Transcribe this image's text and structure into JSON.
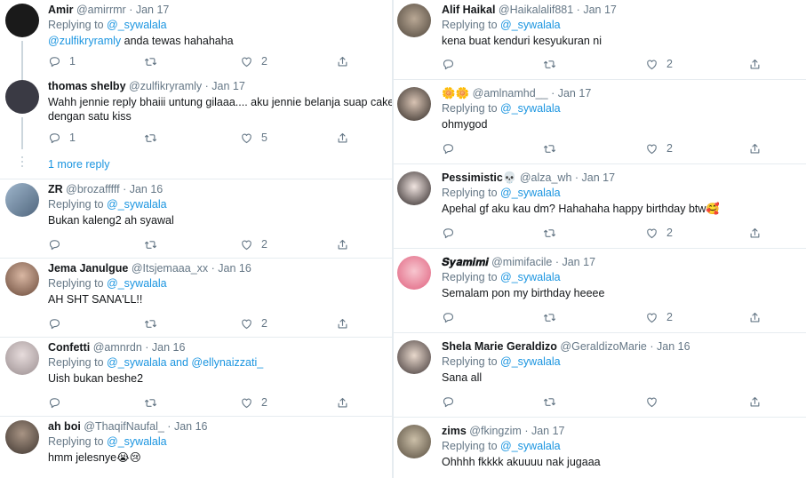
{
  "left": [
    {
      "name": "Amir",
      "handle": "@amirrmr",
      "date": "Jan 17",
      "reply_prefix": "Replying to",
      "reply_to": "@_sywalala",
      "reply_to2": "",
      "text_mention": "@zulfikryramly",
      "text": " anda tewas hahahaha",
      "text2": "",
      "replies": "1",
      "retweets": "",
      "likes": "2",
      "avatar": "#1a1a1a"
    },
    {
      "name": "thomas shelby",
      "handle": "@zulfikryramly",
      "date": "Jan 17",
      "reply_prefix": "",
      "reply_to": "",
      "reply_to2": "",
      "text_mention": "",
      "text": "Wahh jennie reply bhaiii untung gilaaa.... aku jennie belanja suap cake je",
      "text2": "dengan satu kiss",
      "replies": "1",
      "retweets": "",
      "likes": "5",
      "avatar": "#3a3a44"
    },
    {
      "name": "ZR",
      "handle": "@brozafffff",
      "date": "Jan 16",
      "reply_prefix": "Replying to",
      "reply_to": "@_sywalala",
      "reply_to2": "",
      "text_mention": "",
      "text": "Bukan kaleng2 ah syawal",
      "text2": "",
      "replies": "",
      "retweets": "",
      "likes": "2",
      "avatar": "#6d8aa8"
    },
    {
      "name": "Jema Janulgue",
      "handle": "@Itsjemaaa_xx",
      "date": "Jan 16",
      "reply_prefix": "Replying to",
      "reply_to": "@_sywalala",
      "reply_to2": "",
      "text_mention": "",
      "text": "AH SHT SANA'LL!!",
      "text2": "",
      "replies": "",
      "retweets": "",
      "likes": "2",
      "avatar": "#8a6a5a"
    },
    {
      "name": "Confetti",
      "handle": "@amnrdn",
      "date": "Jan 16",
      "reply_prefix": "Replying to",
      "reply_to": "@_sywalala and @ellynaizzati_",
      "reply_to2": "",
      "text_mention": "",
      "text": "Uish bukan beshe2",
      "text2": "",
      "replies": "",
      "retweets": "",
      "likes": "2",
      "avatar": "#b9aeb0"
    },
    {
      "name": "ah boi",
      "handle": "@ThaqifNaufal_",
      "date": "Jan 16",
      "reply_prefix": "Replying to",
      "reply_to": "@_sywalala",
      "reply_to2": "",
      "text_mention": "",
      "text": "hmm jelesnye😭😢",
      "text2": "",
      "replies": "",
      "retweets": "",
      "likes": "",
      "avatar": "#5b5048"
    }
  ],
  "more_reply_label": "1 more reply",
  "right": [
    {
      "name": "Alif Haikal",
      "handle": "@Haikalalif881",
      "date": "Jan 17",
      "reply_prefix": "Replying to",
      "reply_to": "@_sywalala",
      "text": "kena buat kenduri kesyukuran ni",
      "replies": "",
      "retweets": "",
      "likes": "2",
      "avatar": "#6b6258"
    },
    {
      "name": "🌼🌼",
      "handle": "@amlnamhd__",
      "date": "Jan 17",
      "reply_prefix": "Replying to",
      "reply_to": "@_sywalala",
      "text": "ohmygod",
      "replies": "",
      "retweets": "",
      "likes": "2",
      "avatar": "#3b3530"
    },
    {
      "name": "Pessimistic💀",
      "handle": "@alza_wh",
      "date": "Jan 17",
      "reply_prefix": "Replying to",
      "reply_to": "@_sywalala",
      "text": "Apehal gf aku kau dm?  Hahahaha happy birthday btw🥰",
      "replies": "",
      "retweets": "",
      "likes": "2",
      "avatar": "#2e2a2a"
    },
    {
      "name": "𝑺𝒚𝒂𝒎𝒊𝒎𝒊",
      "handle": "@mimifacile",
      "date": "Jan 17",
      "reply_prefix": "Replying to",
      "reply_to": "@_sywalala",
      "text": "Semalam pon my birthday heeee",
      "replies": "",
      "retweets": "",
      "likes": "2",
      "avatar": "#e88aa0"
    },
    {
      "name": "Shela Marie Geraldizo",
      "handle": "@GeraldizoMarie",
      "date": "Jan 16",
      "reply_prefix": "Replying to",
      "reply_to": "@_sywalala",
      "text": "Sana all",
      "replies": "",
      "retweets": "",
      "likes": "",
      "avatar": "#4a4040"
    },
    {
      "name": "zims",
      "handle": "@fkingzim",
      "date": "Jan 17",
      "reply_prefix": "Replying to",
      "reply_to": "@_sywalala",
      "text": "Ohhhh fkkkk akuuuu nak jugaaa",
      "replies": "",
      "retweets": "",
      "likes": "",
      "avatar": "#7a7060"
    }
  ]
}
